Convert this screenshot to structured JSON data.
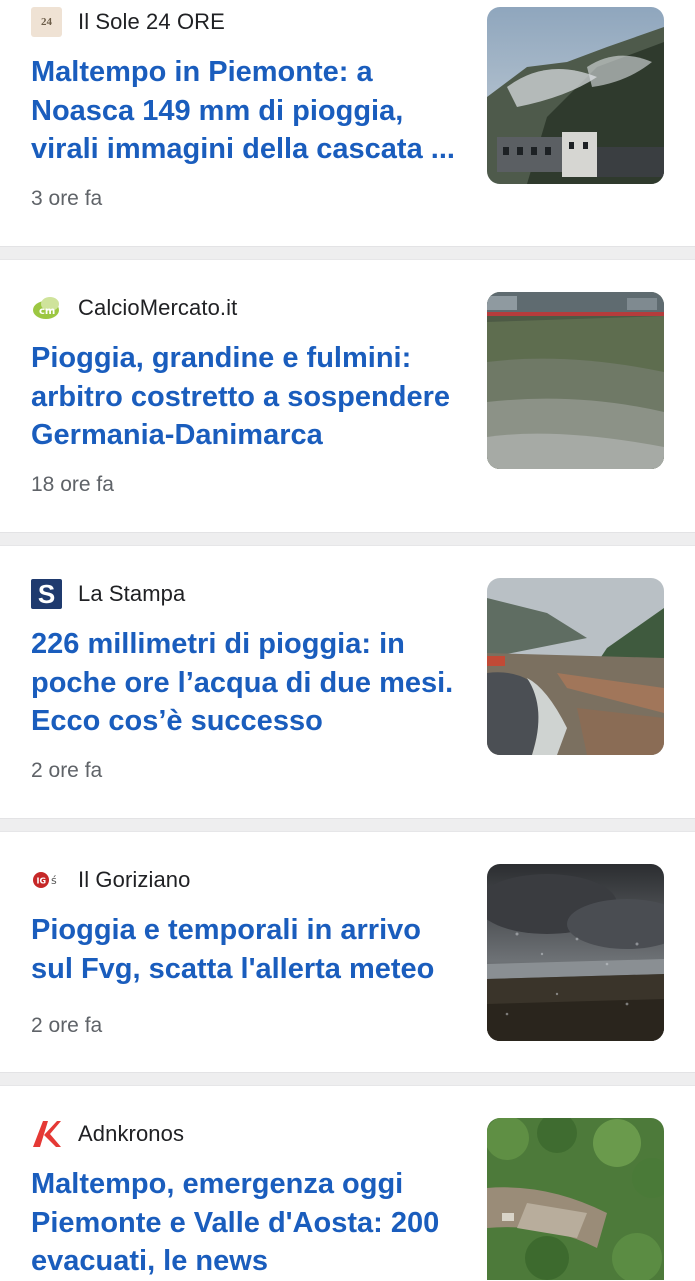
{
  "articles": [
    {
      "source": "Il Sole 24 ORE",
      "source_logo": "sole24ore-logo",
      "title_lines": [
        "Maltempo in Piemonte: a",
        "Noasca 149 mm di pioggia,",
        "virali immagini della cascata ..."
      ],
      "time": "3 ore fa",
      "thumbnail": "mountain-village-photo"
    },
    {
      "source": "CalcioMercato.it",
      "source_logo": "calciomercato-logo",
      "title_lines": [
        "Pioggia, grandine e fulmini:",
        "arbitro costretto a sospendere",
        "Germania-Danimarca"
      ],
      "time": "18 ore fa",
      "thumbnail": "flooded-pitch-photo"
    },
    {
      "source": "La Stampa",
      "source_logo": "lastampa-logo",
      "title_lines": [
        "226 millimetri di pioggia: in",
        "poche ore l’acqua di due mesi.",
        "Ecco cos’è successo"
      ],
      "time": "2 ore fa",
      "thumbnail": "flooded-valley-road-photo"
    },
    {
      "source": "Il Goriziano",
      "source_logo": "ilgoriziano-logo",
      "title_lines": [
        "Pioggia e temporali in arrivo",
        "sul Fvg, scatta l'allerta meteo"
      ],
      "time": "2 ore fa",
      "thumbnail": "storm-clouds-photo"
    },
    {
      "source": "Adnkronos",
      "source_logo": "adnkronos-logo",
      "title_lines": [
        "Maltempo, emergenza oggi",
        "Piemonte e Valle d'Aosta: 200",
        "evacuati, le news"
      ],
      "time": "",
      "thumbnail": "landslide-aerial-photo"
    }
  ],
  "colors": {
    "headline": "#1a5dbd",
    "source_text": "#202124",
    "time_text": "#5f6368",
    "separator": "#eeeeef"
  }
}
